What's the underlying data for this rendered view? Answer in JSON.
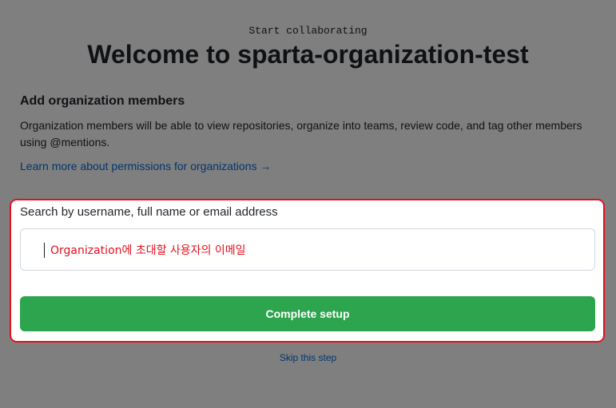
{
  "header": {
    "eyebrow": "Start collaborating",
    "title": "Welcome to sparta-organization-test"
  },
  "members_section": {
    "heading": "Add organization members",
    "description": "Organization members will be able to view repositories, organize into teams, review code, and tag other members using @mentions.",
    "learn_more_link": "Learn more about permissions for organizations →"
  },
  "search": {
    "label": "Search by username, full name or email address",
    "value": "",
    "annotation": "Organization에 초대할 사용자의 이메일"
  },
  "actions": {
    "complete_label": "Complete setup",
    "skip_label": "Skip this step"
  },
  "colors": {
    "primary_button": "#2da44e",
    "link": "#0969da",
    "annotation_red": "#e3111f"
  }
}
